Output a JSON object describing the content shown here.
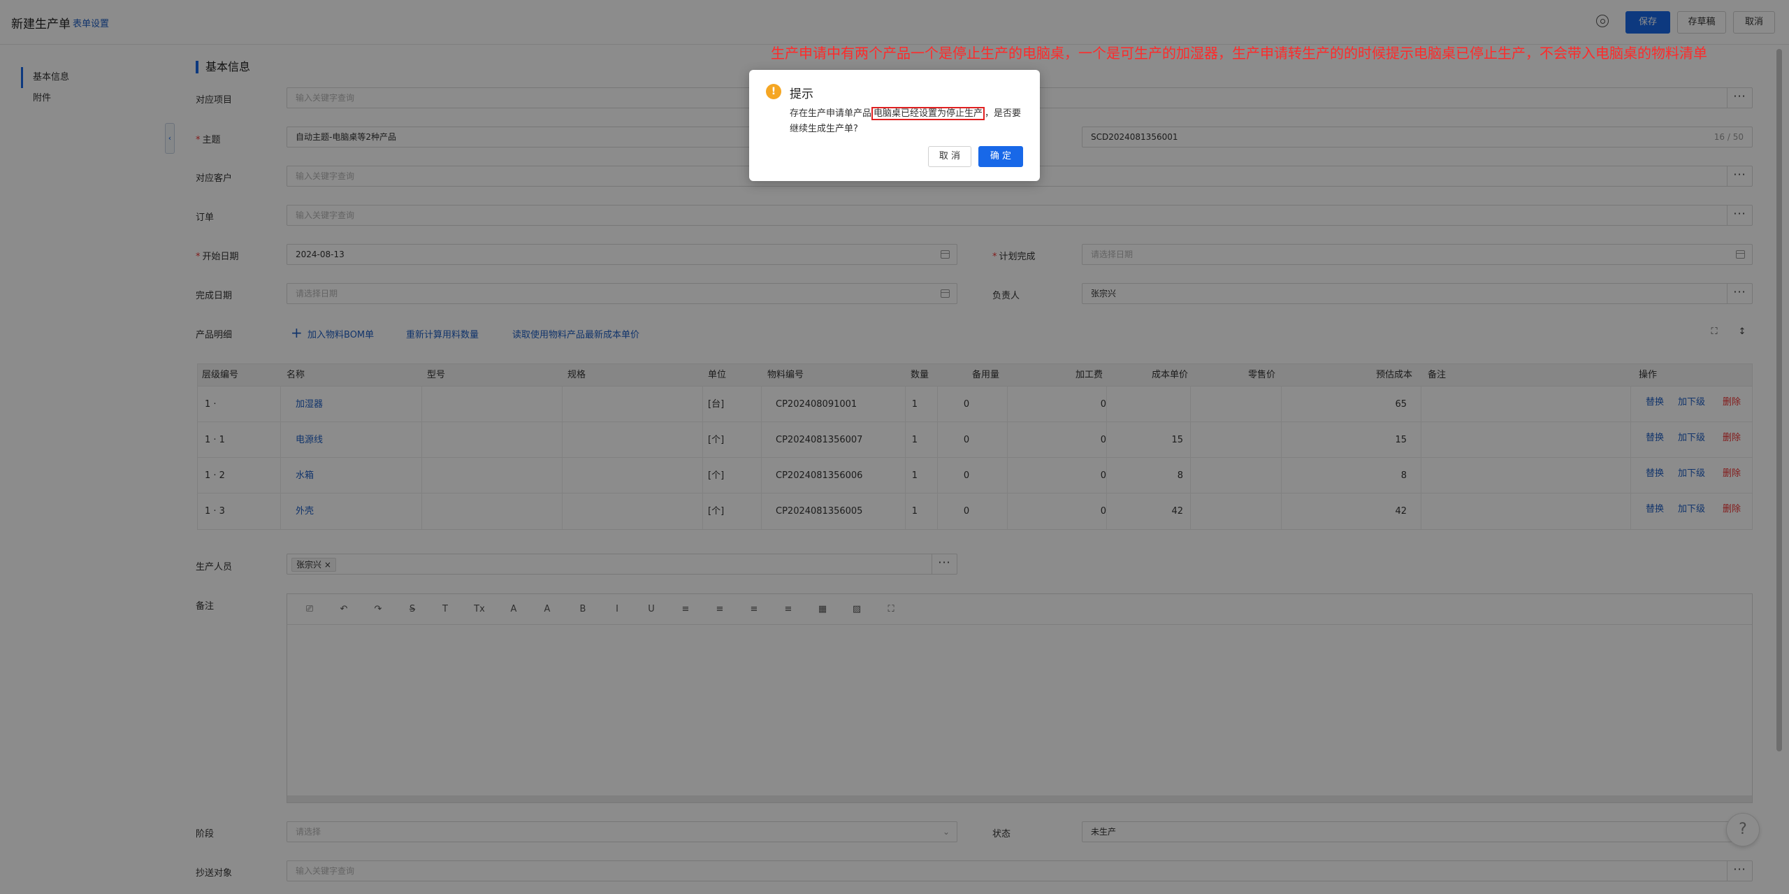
{
  "header": {
    "title": "新建生产单",
    "subtitle": "表单设置",
    "save": "保存",
    "draft": "存草稿",
    "cancel": "取消"
  },
  "sidebar": {
    "items": [
      {
        "label": "基本信息"
      },
      {
        "label": "附件"
      }
    ]
  },
  "form": {
    "section_title": "基本信息",
    "project": {
      "label": "对应项目",
      "placeholder": "输入关键字查询"
    },
    "subject": {
      "label": "主题",
      "value": "自动主题-电脑桌等2种产品"
    },
    "code": {
      "value": "SCD2024081356001",
      "count": "16 / 50"
    },
    "customer": {
      "label": "对应客户",
      "placeholder": "输入关键字查询"
    },
    "order": {
      "label": "订单",
      "placeholder": "输入关键字查询"
    },
    "start_date": {
      "label": "开始日期",
      "value": "2024-08-13"
    },
    "plan_finish": {
      "label": "计划完成",
      "placeholder": "请选择日期"
    },
    "finish_date": {
      "label": "完成日期",
      "placeholder": "请选择日期"
    },
    "owner": {
      "label": "负责人",
      "value": "张宗兴"
    },
    "product_detail": {
      "label": "产品明细",
      "add_bom": "加入物料BOM单",
      "recalc": "重新计算用料数量",
      "read_cost": "读取使用物料产品最新成本单价"
    },
    "staff": {
      "label": "生产人员",
      "tag": "张宗兴"
    },
    "remark": {
      "label": "备注"
    },
    "stage": {
      "label": "阶段",
      "placeholder": "请选择"
    },
    "status": {
      "label": "状态",
      "value": "未生产"
    },
    "cc": {
      "label": "抄送对象",
      "placeholder": "输入关键字查询"
    }
  },
  "table": {
    "headers": [
      "层级编号",
      "名称",
      "型号",
      "规格",
      "单位",
      "物料编号",
      "数量",
      "备用量",
      "加工费",
      "成本单价",
      "零售价",
      "预估成本",
      "备注",
      "操作"
    ],
    "rows": [
      {
        "level": "1 ·",
        "name": "加湿器",
        "model": "",
        "spec": "",
        "unit": "[台]",
        "code": "CP202408091001",
        "qty": "1",
        "spare": "0",
        "fee": "0",
        "unit_cost": "",
        "retail": "",
        "est_cost": "65",
        "note": ""
      },
      {
        "level": "1 · 1",
        "name": "电源线",
        "model": "",
        "spec": "",
        "unit": "[个]",
        "code": "CP2024081356007",
        "qty": "1",
        "spare": "0",
        "fee": "0",
        "unit_cost": "15",
        "retail": "",
        "est_cost": "15",
        "note": ""
      },
      {
        "level": "1 · 2",
        "name": "水箱",
        "model": "",
        "spec": "",
        "unit": "[个]",
        "code": "CP2024081356006",
        "qty": "1",
        "spare": "0",
        "fee": "0",
        "unit_cost": "8",
        "retail": "",
        "est_cost": "8",
        "note": ""
      },
      {
        "level": "1 · 3",
        "name": "外壳",
        "model": "",
        "spec": "",
        "unit": "[个]",
        "code": "CP2024081356005",
        "qty": "1",
        "spare": "0",
        "fee": "0",
        "unit_cost": "42",
        "retail": "",
        "est_cost": "42",
        "note": ""
      }
    ],
    "actions": {
      "replace": "替换",
      "add_child": "加下级",
      "delete": "删除"
    }
  },
  "editor": {
    "tools": [
      "format-brush-icon",
      "undo-icon",
      "redo-icon",
      "strikethrough-icon",
      "text-icon",
      "clear-format-icon",
      "font-color-icon",
      "bg-color-icon",
      "bold-icon",
      "italic-icon",
      "underline-icon",
      "align-left-icon",
      "align-center-icon",
      "align-right-icon",
      "justify-icon",
      "table-icon",
      "image-icon",
      "fullscreen-icon"
    ],
    "tool_glyphs": [
      "⎚",
      "↶",
      "↷",
      "S̶",
      "T",
      "Tx",
      "A",
      "A",
      "B",
      "I",
      "U",
      "≡",
      "≡",
      "≡",
      "≡",
      "▦",
      "▨",
      "⛶"
    ]
  },
  "dialog": {
    "title": "提示",
    "msg_prefix": "存在生产申请单产品",
    "msg_highlight": "电脑桌已经设置为停止生产",
    "msg_suffix": "，是否要继续生成生产单?",
    "cancel": "取 消",
    "ok": "确 定"
  },
  "annotation": "生产申请中有两个产品一个是停止生产的电脑桌，一个是可生产的加湿器，生产申请转生产的的时候提示电脑桌已停止生产，不会带入电脑桌的物料清单",
  "colors": {
    "primary": "#1868e8",
    "link": "#1f5fc4",
    "danger": "#e33333",
    "warning": "#f5a623",
    "annotation": "#ff2a2a"
  }
}
